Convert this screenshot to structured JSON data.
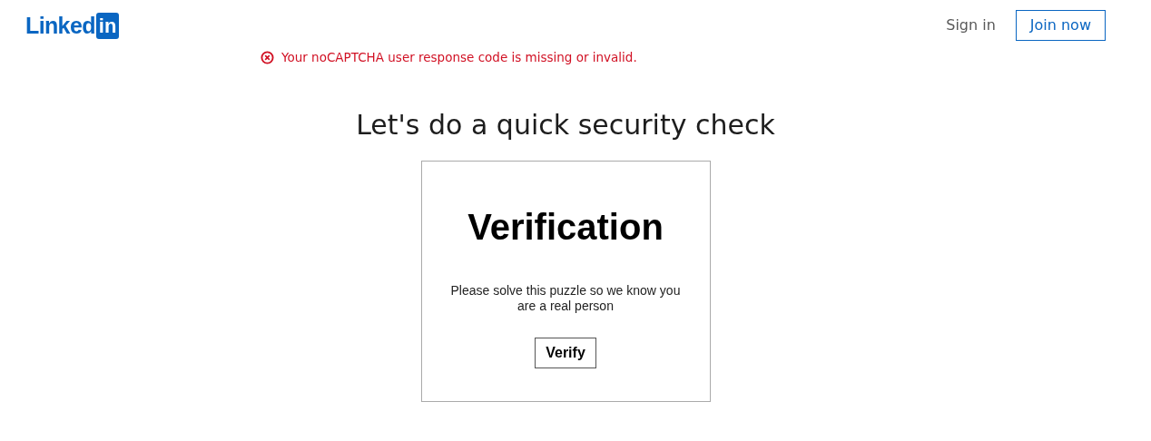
{
  "header": {
    "logo": {
      "text": "Linked",
      "badge": "in"
    },
    "sign_in": "Sign in",
    "join_now": "Join now"
  },
  "error": {
    "message": "Your noCAPTCHA user response code is missing or invalid."
  },
  "title": "Let's do a quick security check",
  "verification": {
    "heading": "Verification",
    "instructions": "Please solve this puzzle so we know you are a real person",
    "button": "Verify"
  }
}
